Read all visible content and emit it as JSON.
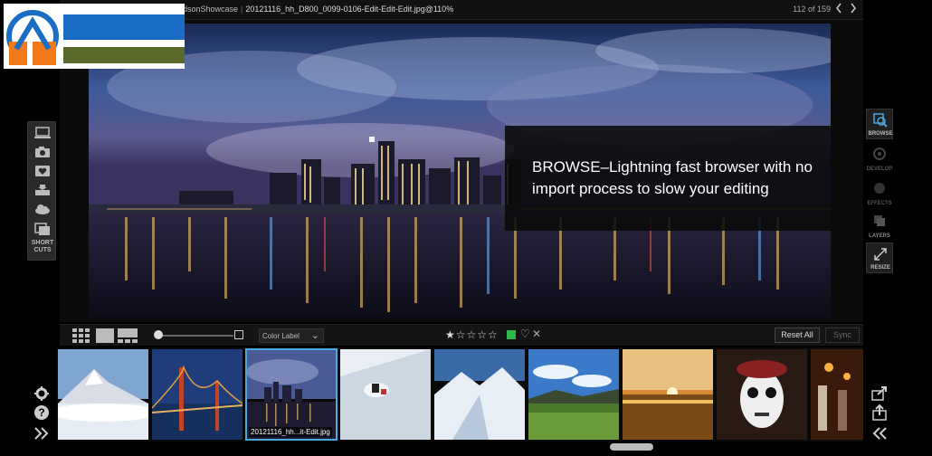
{
  "title_bar": {
    "path_fragment": "dsonShowcase",
    "separator": "|",
    "filename": "20121116_hh_D800_0099-0106-Edit-Edit-Edit.jpg@110%",
    "counter": "112 of 159",
    "prev_icon": "chevron-left-icon",
    "next_icon": "chevron-right-icon"
  },
  "logo": {
    "colors": {
      "blue": "#1a6cc4",
      "green": "#5a6a2a",
      "orange": "#f07a1a"
    }
  },
  "left_tools": {
    "items": [
      "laptop-icon",
      "camera-icon",
      "favorites-icon",
      "drive-icon",
      "cloud-icon",
      "shortcuts-icon"
    ],
    "shortcuts_label_line1": "SHORT",
    "shortcuts_label_line2": "CUTS"
  },
  "overlay": {
    "text": "BROWSE–Lightning fast browser with no import process to slow your editing"
  },
  "right_tools": {
    "items": [
      {
        "icon": "browse-icon",
        "label": "BROWSE",
        "active": true
      },
      {
        "icon": "develop-icon",
        "label": "DEVELOP",
        "active": false
      },
      {
        "icon": "effects-icon",
        "label": "EFFECTS",
        "active": false
      },
      {
        "icon": "layers-icon",
        "label": "LAYERS",
        "active": false
      },
      {
        "icon": "resize-icon",
        "label": "RESIZE",
        "active": true
      }
    ]
  },
  "filmstrip_toolbar": {
    "color_label": "Color Label",
    "rating_stars": "★☆☆☆☆",
    "rating": 1,
    "rating_max": 5,
    "heart": "♡",
    "reject": "✕",
    "reset_all": "Reset All",
    "sync": "Sync",
    "accent_color": "#2fb84a"
  },
  "filmstrip": {
    "thumbs": [
      {
        "subject": "mountain-thumb",
        "caption": ""
      },
      {
        "subject": "bridge-thumb",
        "caption": ""
      },
      {
        "subject": "city-thumb",
        "caption": "20121116_hh...it-Edit.jpg",
        "selected": true
      },
      {
        "subject": "skier-thumb",
        "caption": ""
      },
      {
        "subject": "snow-thumb",
        "caption": ""
      },
      {
        "subject": "valley-thumb",
        "caption": ""
      },
      {
        "subject": "sunset-thumb",
        "caption": ""
      },
      {
        "subject": "skull-thumb",
        "caption": ""
      },
      {
        "subject": "festival-thumb",
        "caption": ""
      }
    ],
    "selection_color": "#4aa8e0"
  },
  "bottom_left": [
    "gear-icon",
    "help-icon",
    "expand-right-icon"
  ],
  "bottom_right": [
    "export-icon",
    "share-icon",
    "collapse-left-icon"
  ]
}
